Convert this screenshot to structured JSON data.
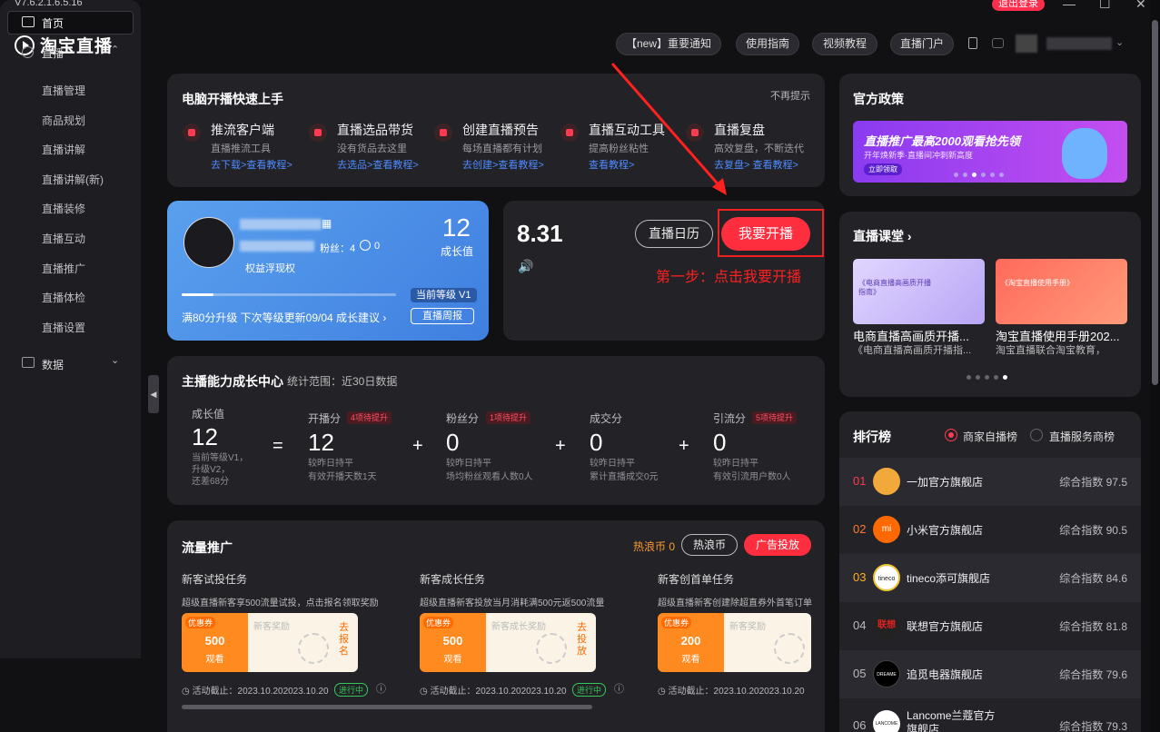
{
  "titlebar": {
    "version": "V7.6.2.1.6.5.16",
    "logout": "退出登录",
    "minimize": "—",
    "maximize": "☐",
    "close": "✕"
  },
  "app": {
    "name": "淘宝直播"
  },
  "top_nav": {
    "notice": "【new】重要通知",
    "guide": "使用指南",
    "video": "视频教程",
    "portal": "直播门户"
  },
  "sidebar": {
    "home": "首页",
    "live": "直播",
    "live_items": [
      "直播管理",
      "商品规划",
      "直播讲解",
      "直播讲解(新)",
      "直播装修",
      "直播互动",
      "直播推广",
      "直播体检",
      "直播设置"
    ],
    "data": "数据"
  },
  "quickstart": {
    "title": "电脑开播快速上手",
    "dismiss": "不再提示",
    "items": [
      {
        "title": "推流客户端",
        "desc": "直播推流工具",
        "link": "去下载>查看教程>"
      },
      {
        "title": "直播选品带货",
        "desc": "没有货品去这里",
        "link": "去选品>查看教程>"
      },
      {
        "title": "创建直播预告",
        "desc": "每场直播都有计划",
        "link": "去创建>查看教程>"
      },
      {
        "title": "直播互动工具",
        "desc": "提高粉丝粘性",
        "link": "查看教程>"
      },
      {
        "title": "直播复盘",
        "desc": "高效复盘，不断迭代",
        "link": "去复盘> 查看教程>"
      }
    ]
  },
  "profile": {
    "fans_label": "粉丝：4",
    "other": "0",
    "rights": "权益浮现权",
    "growth_value": "12",
    "growth_label": "成长值",
    "level": "当前等级 V1",
    "upgrade_text": "满80分升级 下次等级更新09/04 成长建议 ›",
    "weekly": "直播周报",
    "progress": 0.15
  },
  "live_panel": {
    "date": "8.31",
    "calendar": "直播日历",
    "start": "我要开播",
    "volume_icon": "🔊"
  },
  "annotation": {
    "text": "第一步：点击我要开播"
  },
  "growth": {
    "title": "主播能力成长中心",
    "range": "统计范围：近30日数据",
    "total": {
      "label": "成长值",
      "value": "12",
      "sub1": "当前等级V1，",
      "sub2": "升级V2，",
      "sub3": "还差68分"
    },
    "metrics": [
      {
        "label": "开播分",
        "tag": "4项待提升",
        "value": "12",
        "sub1": "较昨日持平",
        "sub2": "有效开播天数1天"
      },
      {
        "label": "粉丝分",
        "tag": "1项待提升",
        "value": "0",
        "sub1": "较昨日持平",
        "sub2": "场均粉丝观看人数0人"
      },
      {
        "label": "成交分",
        "tag": "",
        "value": "0",
        "sub1": "较昨日持平",
        "sub2": "累计直播成交0元"
      },
      {
        "label": "引流分",
        "tag": "5项待提升",
        "value": "0",
        "sub1": "较昨日持平",
        "sub2": "有效引流用户数0人"
      }
    ]
  },
  "traffic": {
    "title": "流量推广",
    "coins": "热浪币 0",
    "coins_btn": "热浪币",
    "ad_btn": "广告投放",
    "tasks": [
      {
        "title": "新客试投任务",
        "desc": "超级直播新客享500流量试投，点击报名领取奖励",
        "tag": "优惠券",
        "amount": "500",
        "unit": "观看",
        "reward": "新客奖励",
        "action": "去报名",
        "deadline": "活动截止：2023.10.202023.10.20",
        "status": "进行中"
      },
      {
        "title": "新客成长任务",
        "desc": "超级直播新客投放当月消耗满500元返500流量",
        "tag": "优惠券",
        "amount": "500",
        "unit": "观看",
        "reward": "新客成长奖励",
        "action": "去投放",
        "deadline": "活动截止：2023.10.202023.10.20",
        "status": "进行中"
      },
      {
        "title": "新客创首单任务",
        "desc": "超级直播新客创建除超直券外首笔订单",
        "tag": "优惠券",
        "amount": "200",
        "unit": "观看",
        "reward": "新客奖励",
        "action": "",
        "deadline": "活动截止：2023.10.202023.10.20",
        "status": ""
      }
    ]
  },
  "policy": {
    "title": "官方政策",
    "banner_title": "直播推广最高2000观看抢先领",
    "banner_sub": "开年焕新季·直播间冲刺新高度",
    "banner_btn": "立即领取"
  },
  "course": {
    "title": "直播课堂 ›",
    "items": [
      {
        "title": "电商直播高画质开播...",
        "sub": "《电商直播高画质开播指...",
        "thumb": "《电商直播高画质开播指南》"
      },
      {
        "title": "淘宝直播使用手册202...",
        "sub": "淘宝直播联合淘宝教育，",
        "thumb": "《淘宝直播使用手册》"
      }
    ]
  },
  "ranking": {
    "title": "排行榜",
    "tab1": "商家自播榜",
    "tab2": "直播服务商榜",
    "rows": [
      {
        "num": "01",
        "name": "一加官方旗舰店",
        "score": "综合指数 97.5",
        "logo": "#f2a93b"
      },
      {
        "num": "02",
        "name": "小米官方旗舰店",
        "score": "综合指数 90.5",
        "logo": "#ff6900",
        "logo_text": "mi"
      },
      {
        "num": "03",
        "name": "tineco添可旗舰店",
        "score": "综合指数 84.6",
        "logo": "#ffffff",
        "logo_text": "tineco"
      },
      {
        "num": "04",
        "name": "联想官方旗舰店",
        "score": "综合指数 81.8",
        "logo": "#222222",
        "logo_text": "联想"
      },
      {
        "num": "05",
        "name": "追觅电器旗舰店",
        "score": "综合指数 79.6",
        "logo": "#000000",
        "logo_text": "DREAME"
      },
      {
        "num": "06",
        "name": "Lancome兰蔻官方旗舰店",
        "score": "综合指数 79.3",
        "logo": "#ffffff",
        "logo_text": "LANCOME"
      }
    ]
  }
}
